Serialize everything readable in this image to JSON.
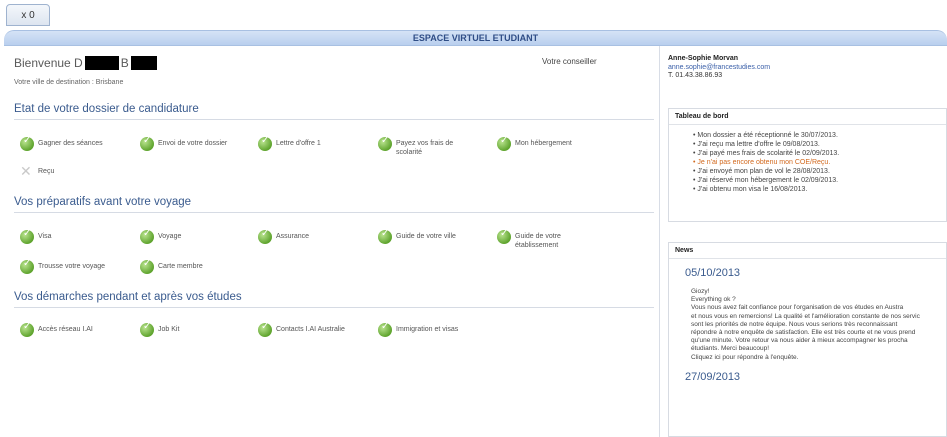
{
  "browser": {
    "tab_label": "x 0"
  },
  "header": {
    "title": "ESPACE VIRTUEL ETUDIANT"
  },
  "welcome": {
    "prefix": "Bienvenue D",
    "mid": "B",
    "city": "Votre ville de destination : Brisbane",
    "counselor_label": "Votre conseiller"
  },
  "sections": [
    {
      "title": "Etat de votre dossier de candidature",
      "items": [
        {
          "label": "Gagner des séances",
          "status": "done"
        },
        {
          "label": "Envoi de votre dossier",
          "status": "done"
        },
        {
          "label": "Lettre d'offre 1",
          "status": "done"
        },
        {
          "label": "Payez vos frais de scolarité",
          "status": "done"
        },
        {
          "label": "Mon hébergement",
          "status": "done"
        },
        {
          "label": "Reçu",
          "status": "pending"
        }
      ]
    },
    {
      "title": "Vos préparatifs avant votre voyage",
      "items": [
        {
          "label": "Visa",
          "status": "done"
        },
        {
          "label": "Voyage",
          "status": "done"
        },
        {
          "label": "Assurance",
          "status": "done"
        },
        {
          "label": "Guide de votre ville",
          "status": "done"
        },
        {
          "label": "Guide de votre établissement",
          "status": "done"
        },
        {
          "label": "Trousse votre voyage",
          "status": "done"
        },
        {
          "label": "Carte membre",
          "status": "done"
        }
      ]
    },
    {
      "title": "Vos démarches pendant et après vos études",
      "items": [
        {
          "label": "Accès réseau I.AI",
          "status": "done"
        },
        {
          "label": "Job Kit",
          "status": "done"
        },
        {
          "label": "Contacts I.AI Australie",
          "status": "done"
        },
        {
          "label": "Immigration et visas",
          "status": "done"
        }
      ]
    }
  ],
  "contact": {
    "name": "Anne-Sophie Morvan",
    "email": "anne.sophie@francestudies.com",
    "phone": "T. 01.43.38.86.93"
  },
  "dashboard": {
    "title": "Tableau de bord",
    "items": [
      {
        "text": "Mon dossier a été réceptionné le 30/07/2013.",
        "alert": false
      },
      {
        "text": "J'ai reçu ma lettre d'offre le 09/08/2013.",
        "alert": false
      },
      {
        "text": "J'ai payé mes frais de scolarité le 02/09/2013.",
        "alert": false
      },
      {
        "text": "Je n'ai pas encore obtenu mon COE/Reçu.",
        "alert": true
      },
      {
        "text": "J'ai envoyé mon plan de vol le 28/08/2013.",
        "alert": false
      },
      {
        "text": "J'ai réservé mon hébergement le 02/09/2013.",
        "alert": false
      },
      {
        "text": "J'ai obtenu mon visa le 16/08/2013.",
        "alert": false
      }
    ]
  },
  "news": {
    "title": "News",
    "entries": [
      {
        "date": "05/10/2013",
        "lines": [
          "Giozy!",
          "Everything ok ?",
          "Vous nous avez fait confiance pour l'organisation de vos études en Austra",
          "et nous vous en remercions! La qualité et l'amélioration constante de nos servic",
          "sont les priorités de notre équipe.  Nous vous serions très reconnaissant",
          "répondre à notre enquête de satisfaction. Elle est très courte et ne vous prend",
          "qu'une minute. Votre retour va nous aider à mieux accompagner les procha",
          "étudiants. Merci beaucoup!",
          "Cliquez ici pour répondre à l'enquête."
        ]
      },
      {
        "date": "27/09/2013",
        "lines": []
      }
    ]
  }
}
